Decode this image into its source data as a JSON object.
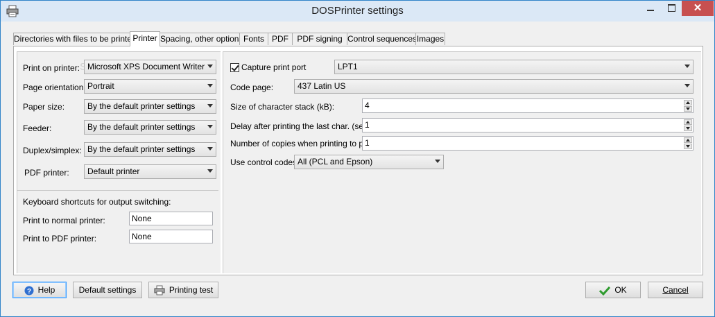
{
  "window": {
    "title": "DOSPrinter settings"
  },
  "tabs": [
    {
      "label": "Directories with files to be printed",
      "active": false
    },
    {
      "label": "Printer",
      "active": true
    },
    {
      "label": "Spacing, other options",
      "active": false
    },
    {
      "label": "Fonts",
      "active": false
    },
    {
      "label": "PDF",
      "active": false
    },
    {
      "label": "PDF signing",
      "active": false
    },
    {
      "label": "Control sequences",
      "active": false
    },
    {
      "label": "Images",
      "active": false
    }
  ],
  "left": {
    "print_on_printer": {
      "label": "Print on printer:",
      "value": "Microsoft XPS Document Writer"
    },
    "page_orientation": {
      "label": "Page orientation:",
      "value": "Portrait"
    },
    "paper_size": {
      "label": "Paper size:",
      "value": "By the default printer settings"
    },
    "feeder": {
      "label": "Feeder:",
      "value": "By the default printer settings"
    },
    "duplex": {
      "label": "Duplex/simplex:",
      "value": "By the default printer settings"
    },
    "pdf_printer": {
      "label": "PDF printer:",
      "value": "Default printer"
    },
    "shortcuts_heading": "Keyboard shortcuts for output switching:",
    "normal_printer": {
      "label": "Print to normal printer:",
      "value": "None"
    },
    "pdf_printer_shortcut": {
      "label": "Print to PDF printer:",
      "value": "None"
    }
  },
  "right": {
    "capture": {
      "label": "Capture print port",
      "checked": true,
      "value": "LPT1"
    },
    "code_page": {
      "label": "Code page:",
      "value": "437 Latin US"
    },
    "char_stack": {
      "label": "Size of character stack (kB):",
      "value": "4"
    },
    "delay": {
      "label": "Delay after printing the last char. (sec):",
      "value": "1"
    },
    "copies": {
      "label": "Number of copies when printing to port:",
      "value": "1"
    },
    "control_codes": {
      "label": "Use control codes:",
      "value": "All (PCL and Epson)"
    }
  },
  "buttons": {
    "help": "Help",
    "default_settings": "Default settings",
    "printing_test": "Printing test",
    "ok": "OK",
    "cancel": "Cancel"
  },
  "icons": {
    "app": "printer-icon",
    "help": "help-icon",
    "printing_test": "printer-icon",
    "ok": "checkmark-icon"
  },
  "colors": {
    "titlebar": "#dbe8f6",
    "close": "#c75050",
    "window_border": "#2f83c8"
  }
}
